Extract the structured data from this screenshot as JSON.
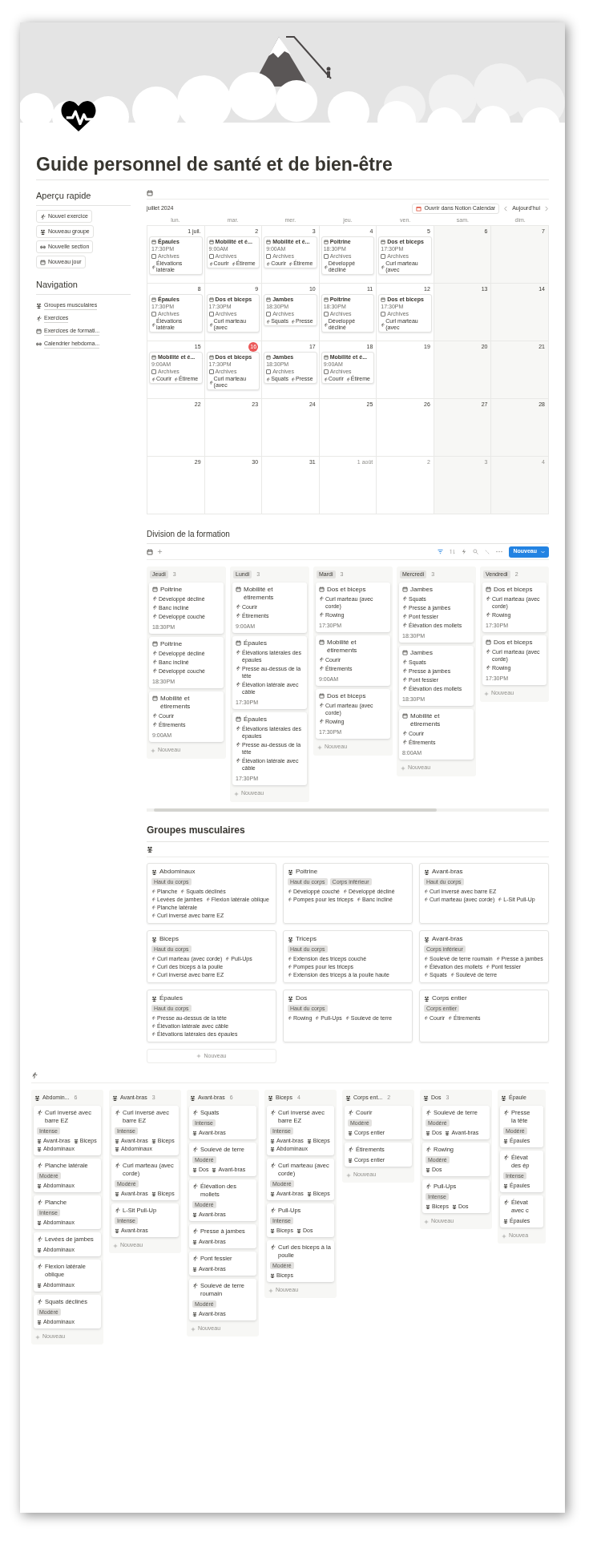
{
  "title": "Guide personnel de santé et de bien-être",
  "sidebar": {
    "quick_title": "Aperçu rapide",
    "quick_buttons": [
      {
        "label": "Nouvel exercice"
      },
      {
        "label": "Nouveau groupe"
      },
      {
        "label": "Nouvelle section"
      },
      {
        "label": "Nouveau jour"
      }
    ],
    "nav_title": "Navigation",
    "nav_links": [
      {
        "label": "Groupes musculaires"
      },
      {
        "label": "Exercices"
      },
      {
        "label": "Exercices de formati..."
      },
      {
        "label": "Calendrier hebdoma..."
      }
    ]
  },
  "calendar": {
    "month": "juillet 2024",
    "open_button": "Ouvrir dans Notion Calendar",
    "today_button": "Aujourd'hui",
    "weekdays": [
      "lun.",
      "mar.",
      "mer.",
      "jeu.",
      "ven.",
      "sam.",
      "dim."
    ],
    "days": [
      {
        "label": "1 juil.",
        "today": false,
        "muted": false,
        "event": {
          "title": "Épaules",
          "time": "17:30PM",
          "checked": false,
          "check_label": "Archives",
          "exercises": [
            "Élévations latérale"
          ]
        }
      },
      {
        "label": "2",
        "today": false,
        "muted": false,
        "event": {
          "title": "Mobilité et é...",
          "time": "9:00AM",
          "checked": false,
          "check_label": "Archives",
          "exercises": [
            "Courir",
            "Étireme"
          ]
        }
      },
      {
        "label": "3",
        "today": false,
        "muted": false,
        "event": {
          "title": "Mobilité et é...",
          "time": "9:00AM",
          "checked": false,
          "check_label": "Archives",
          "exercises": [
            "Courir",
            "Étireme"
          ]
        }
      },
      {
        "label": "4",
        "today": false,
        "muted": false,
        "event": {
          "title": "Poitrine",
          "time": "18:30PM",
          "checked": false,
          "check_label": "Archives",
          "exercises": [
            "Développé décliné"
          ]
        }
      },
      {
        "label": "5",
        "today": false,
        "muted": false,
        "event": {
          "title": "Dos et biceps",
          "time": "17:30PM",
          "checked": false,
          "check_label": "Archives",
          "exercises": [
            "Curl marteau (avec"
          ]
        }
      },
      {
        "label": "6",
        "today": false,
        "muted": false
      },
      {
        "label": "7",
        "today": false,
        "muted": false
      },
      {
        "label": "8",
        "today": false,
        "muted": false,
        "event": {
          "title": "Épaules",
          "time": "17:30PM",
          "checked": false,
          "check_label": "Archives",
          "exercises": [
            "Élévations latérale"
          ]
        }
      },
      {
        "label": "9",
        "today": false,
        "muted": false,
        "event": {
          "title": "Dos et biceps",
          "time": "17:30PM",
          "checked": false,
          "check_label": "Archives",
          "exercises": [
            "Curl marteau (avec"
          ]
        }
      },
      {
        "label": "10",
        "today": false,
        "muted": false,
        "event": {
          "title": "Jambes",
          "time": "18:30PM",
          "checked": false,
          "check_label": "Archives",
          "exercises": [
            "Squats",
            "Presse"
          ]
        }
      },
      {
        "label": "11",
        "today": false,
        "muted": false,
        "event": {
          "title": "Poitrine",
          "time": "18:30PM",
          "checked": false,
          "check_label": "Archives",
          "exercises": [
            "Développé décliné"
          ]
        }
      },
      {
        "label": "12",
        "today": false,
        "muted": false,
        "event": {
          "title": "Dos et biceps",
          "time": "17:30PM",
          "checked": false,
          "check_label": "Archives",
          "exercises": [
            "Curl marteau (avec"
          ]
        }
      },
      {
        "label": "13",
        "today": false,
        "muted": false
      },
      {
        "label": "14",
        "today": false,
        "muted": false
      },
      {
        "label": "15",
        "today": false,
        "muted": false,
        "event": {
          "title": "Mobilité et é...",
          "time": "9:00AM",
          "checked": false,
          "check_label": "Archives",
          "exercises": [
            "Courir",
            "Étireme"
          ]
        }
      },
      {
        "label": "16",
        "today": true,
        "muted": false,
        "event": {
          "title": "Dos et biceps",
          "time": "17:30PM",
          "checked": false,
          "check_label": "Archives",
          "exercises": [
            "Curl marteau (avec"
          ]
        }
      },
      {
        "label": "17",
        "today": false,
        "muted": false,
        "event": {
          "title": "Jambes",
          "time": "18:30PM",
          "checked": false,
          "check_label": "Archives",
          "exercises": [
            "Squats",
            "Presse"
          ]
        }
      },
      {
        "label": "18",
        "today": false,
        "muted": false,
        "event": {
          "title": "Mobilité et é...",
          "time": "9:00AM",
          "checked": false,
          "check_label": "Archives",
          "exercises": [
            "Courir",
            "Étireme"
          ]
        }
      },
      {
        "label": "19",
        "today": false,
        "muted": false
      },
      {
        "label": "20",
        "today": false,
        "muted": false
      },
      {
        "label": "21",
        "today": false,
        "muted": false
      },
      {
        "label": "22",
        "today": false,
        "muted": false
      },
      {
        "label": "23",
        "today": false,
        "muted": false
      },
      {
        "label": "24",
        "today": false,
        "muted": false
      },
      {
        "label": "25",
        "today": false,
        "muted": false
      },
      {
        "label": "26",
        "today": false,
        "muted": false
      },
      {
        "label": "27",
        "today": false,
        "muted": false
      },
      {
        "label": "28",
        "today": false,
        "muted": false
      },
      {
        "label": "29",
        "today": false,
        "muted": false
      },
      {
        "label": "30",
        "today": false,
        "muted": false
      },
      {
        "label": "31",
        "today": false,
        "muted": false
      },
      {
        "label": "1 août",
        "today": false,
        "muted": true
      },
      {
        "label": "2",
        "today": false,
        "muted": true
      },
      {
        "label": "3",
        "today": false,
        "muted": true
      },
      {
        "label": "4",
        "today": false,
        "muted": true
      }
    ]
  },
  "training_split": {
    "title": "Division de la formation",
    "new_button": "Nouveau",
    "columns": [
      {
        "name": "Jeudi",
        "count": "3",
        "new_label": "Nouveau",
        "cards": [
          {
            "title": "Poitrine",
            "exercises": [
              "Développé décliné",
              "Banc incliné",
              "Développé couché"
            ],
            "time": "18:30PM"
          },
          {
            "title": "Poitrine",
            "exercises": [
              "Développé décliné",
              "Banc incliné",
              "Développé couché"
            ],
            "time": "18:30PM"
          },
          {
            "title": "Mobilité et étirements",
            "exercises": [
              "Courir",
              "Étirements"
            ],
            "time": "9:00AM"
          }
        ]
      },
      {
        "name": "Lundi",
        "count": "3",
        "new_label": "Nouveau",
        "cards": [
          {
            "title": "Mobilité et étirements",
            "exercises": [
              "Courir",
              "Étirements"
            ],
            "time": "9:00AM"
          },
          {
            "title": "Épaules",
            "exercises": [
              "Élévations latérales des épaules",
              "Presse au-dessus de la tête",
              "Élévation latérale avec câble"
            ],
            "time": "17:30PM"
          },
          {
            "title": "Épaules",
            "exercises": [
              "Élévations latérales des épaules",
              "Presse au-dessus de la tête",
              "Élévation latérale avec câble"
            ],
            "time": "17:30PM"
          }
        ]
      },
      {
        "name": "Mardi",
        "count": "3",
        "new_label": "Nouveau",
        "cards": [
          {
            "title": "Dos et biceps",
            "exercises": [
              "Curl marteau (avec corde)",
              "Rowing"
            ],
            "time": "17:30PM"
          },
          {
            "title": "Mobilité et étirements",
            "exercises": [
              "Courir",
              "Étirements"
            ],
            "time": "9:00AM"
          },
          {
            "title": "Dos et biceps",
            "exercises": [
              "Curl marteau (avec corde)",
              "Rowing"
            ],
            "time": "17:30PM"
          }
        ]
      },
      {
        "name": "Mercredi",
        "count": "3",
        "new_label": "Nouveau",
        "cards": [
          {
            "title": "Jambes",
            "exercises": [
              "Squats",
              "Presse à jambes",
              "Pont fessier",
              "Élévation des mollets"
            ],
            "time": "18:30PM"
          },
          {
            "title": "Jambes",
            "exercises": [
              "Squats",
              "Presse à jambes",
              "Pont fessier",
              "Élévation des mollets"
            ],
            "time": "18:30PM"
          },
          {
            "title": "Mobilité et étirements",
            "exercises": [
              "Courir",
              "Étirements"
            ],
            "time": "8:00AM"
          }
        ]
      },
      {
        "name": "Vendredi",
        "count": "2",
        "new_label": "Nouveau",
        "cards": [
          {
            "title": "Dos et biceps",
            "exercises": [
              "Curl marteau (avec corde)",
              "Rowing"
            ],
            "time": "17:30PM"
          },
          {
            "title": "Dos et biceps",
            "exercises": [
              "Curl marteau (avec corde)",
              "Rowing"
            ],
            "time": "17:30PM"
          }
        ]
      }
    ]
  },
  "muscle_groups": {
    "title": "Groupes musculaires",
    "new_label": "Nouveau",
    "cards": [
      {
        "title": "Abdominaux",
        "tags": [
          "Haut du corps"
        ],
        "exercises": [
          "Planche",
          "Squats déclinés",
          "Levées de jambes",
          "Flexion latérale oblique",
          "Planche latérale",
          "Curl inversé avec barre EZ"
        ]
      },
      {
        "title": "Poitrine",
        "tags": [
          "Haut du corps",
          "Corps inférieur"
        ],
        "exercises": [
          "Développé couché",
          "Développé décliné",
          "Pompes pour les triceps",
          "Banc incliné"
        ]
      },
      {
        "title": "Avant-bras",
        "tags": [
          "Haut du corps"
        ],
        "exercises": [
          "Curl inversé avec barre EZ",
          "Curl marteau (avec corde)",
          "L-Sit Pull-Up"
        ]
      },
      {
        "title": "Biceps",
        "tags": [
          "Haut du corps"
        ],
        "exercises": [
          "Curl marteau (avec corde)",
          "Pull-Ups",
          "Curl des biceps à la poulie",
          "Curl inversé avec barre EZ"
        ]
      },
      {
        "title": "Triceps",
        "tags": [
          "Haut du corps"
        ],
        "exercises": [
          "Extension des triceps couché",
          "Pompes pour les triceps",
          "Extension des triceps à la poulie haute"
        ]
      },
      {
        "title": "Avant-bras",
        "tags": [
          "Corps inférieur"
        ],
        "exercises": [
          "Soulevé de terre roumain",
          "Presse à jambes",
          "Élévation des mollets",
          "Pont fessier",
          "Squats",
          "Soulevé de terre"
        ]
      },
      {
        "title": "Épaules",
        "tags": [
          "Haut du corps"
        ],
        "exercises": [
          "Presse au-dessus de la tête",
          "Élévation latérale avec câble",
          "Élévations latérales des épaules"
        ]
      },
      {
        "title": "Dos",
        "tags": [
          "Haut du corps"
        ],
        "exercises": [
          "Rowing",
          "Pull-Ups",
          "Soulevé de terre"
        ]
      },
      {
        "title": "Corps entier",
        "tags": [
          "Corps entier"
        ],
        "exercises": [
          "Courir",
          "Étirements"
        ]
      }
    ]
  },
  "exercises_board": {
    "columns": [
      {
        "name": "Abdomin...",
        "count": "6",
        "new_label": "Nouveau",
        "cards": [
          {
            "title": [
              "Curl inversé avec barre EZ"
            ],
            "intensity": "Intense",
            "groups": [
              "Avant-bras",
              "Biceps",
              "Abdominaux"
            ]
          },
          {
            "title": [
              "Planche latérale"
            ],
            "intensity": "Modéré",
            "groups": [
              "Abdominaux"
            ]
          },
          {
            "title": [
              "Planche"
            ],
            "intensity": "Intense",
            "groups": [
              "Abdominaux"
            ]
          },
          {
            "title": [
              "Levées de jambes"
            ],
            "groups": [
              "Abdominaux"
            ]
          },
          {
            "title": [
              "Flexion latérale oblique"
            ],
            "groups": [
              "Abdominaux"
            ]
          },
          {
            "title": [
              "Squats déclinés"
            ],
            "intensity": "Modéré",
            "groups": [
              "Abdominaux"
            ]
          }
        ]
      },
      {
        "name": "Avant-bras",
        "count": "3",
        "new_label": "Nouveau",
        "cards": [
          {
            "title": [
              "Curl inversé avec barre EZ"
            ],
            "intensity": "Intense",
            "groups": [
              "Avant-bras",
              "Biceps",
              "Abdominaux"
            ]
          },
          {
            "title": [
              "Curl marteau (avec corde)"
            ],
            "intensity": "Modéré",
            "groups": [
              "Avant-bras",
              "Biceps"
            ]
          },
          {
            "title": [
              "L-Sit Pull-Up"
            ],
            "intensity": "Intense",
            "groups": [
              "Avant-bras"
            ]
          }
        ]
      },
      {
        "name": "Avant-bras",
        "count": "6",
        "new_label": "Nouveau",
        "cards": [
          {
            "title": [
              "Squats"
            ],
            "intensity": "Intense",
            "groups": [
              "Avant-bras"
            ]
          },
          {
            "title": [
              "Soulevé de terre"
            ],
            "intensity": "Modéré",
            "groups": [
              "Dos",
              "Avant-bras"
            ]
          },
          {
            "title": [
              "Élévation des mollets"
            ],
            "intensity": "Modéré",
            "groups": [
              "Avant-bras"
            ]
          },
          {
            "title": [
              "Presse à jambes"
            ],
            "groups": [
              "Avant-bras"
            ]
          },
          {
            "title": [
              "Pont fessier"
            ],
            "groups": [
              "Avant-bras"
            ]
          },
          {
            "title": [
              "Soulevé de terre roumain"
            ],
            "intensity": "Modéré",
            "groups": [
              "Avant-bras"
            ]
          }
        ]
      },
      {
        "name": "Biceps",
        "count": "4",
        "new_label": "Nouveau",
        "cards": [
          {
            "title": [
              "Curl inversé avec barre EZ"
            ],
            "intensity": "Intense",
            "groups": [
              "Avant-bras",
              "Biceps",
              "Abdominaux"
            ]
          },
          {
            "title": [
              "Curl marteau (avec corde)"
            ],
            "intensity": "Modéré",
            "groups": [
              "Avant-bras",
              "Biceps"
            ]
          },
          {
            "title": [
              "Pull-Ups"
            ],
            "intensity": "Intense",
            "groups": [
              "Biceps",
              "Dos"
            ]
          },
          {
            "title": [
              "Curl des biceps à la poulie"
            ],
            "intensity": "Modéré",
            "groups": [
              "Biceps"
            ]
          }
        ]
      },
      {
        "name": "Corps ent...",
        "count": "2",
        "new_label": "Nouveau",
        "cards": [
          {
            "title": [
              "Courir"
            ],
            "intensity": "Modéré",
            "groups": [
              "Corps entier"
            ]
          },
          {
            "title": [
              "Étirements"
            ],
            "groups": [
              "Corps entier"
            ]
          }
        ]
      },
      {
        "name": "Dos",
        "count": "3",
        "new_label": "Nouveau",
        "cards": [
          {
            "title": [
              "Soulevé de terre"
            ],
            "intensity": "Modéré",
            "groups": [
              "Dos",
              "Avant-bras"
            ]
          },
          {
            "title": [
              "Rowing"
            ],
            "intensity": "Modéré",
            "groups": [
              "Dos"
            ]
          },
          {
            "title": [
              "Pull-Ups"
            ],
            "intensity": "Intense",
            "groups": [
              "Biceps",
              "Dos"
            ]
          }
        ]
      },
      {
        "name": "Épaule",
        "new_label": "Nouvea",
        "cards": [
          {
            "title": [
              "Presse",
              "la tête"
            ],
            "intensity": "Modéré",
            "groups": [
              "Épaules"
            ]
          },
          {
            "title": [
              "Élévat",
              "des ép"
            ],
            "intensity": "Intense",
            "groups": [
              "Épaules"
            ]
          },
          {
            "title": [
              "Élévat",
              "avec c"
            ],
            "groups": [
              "Épaules"
            ]
          }
        ]
      }
    ]
  }
}
